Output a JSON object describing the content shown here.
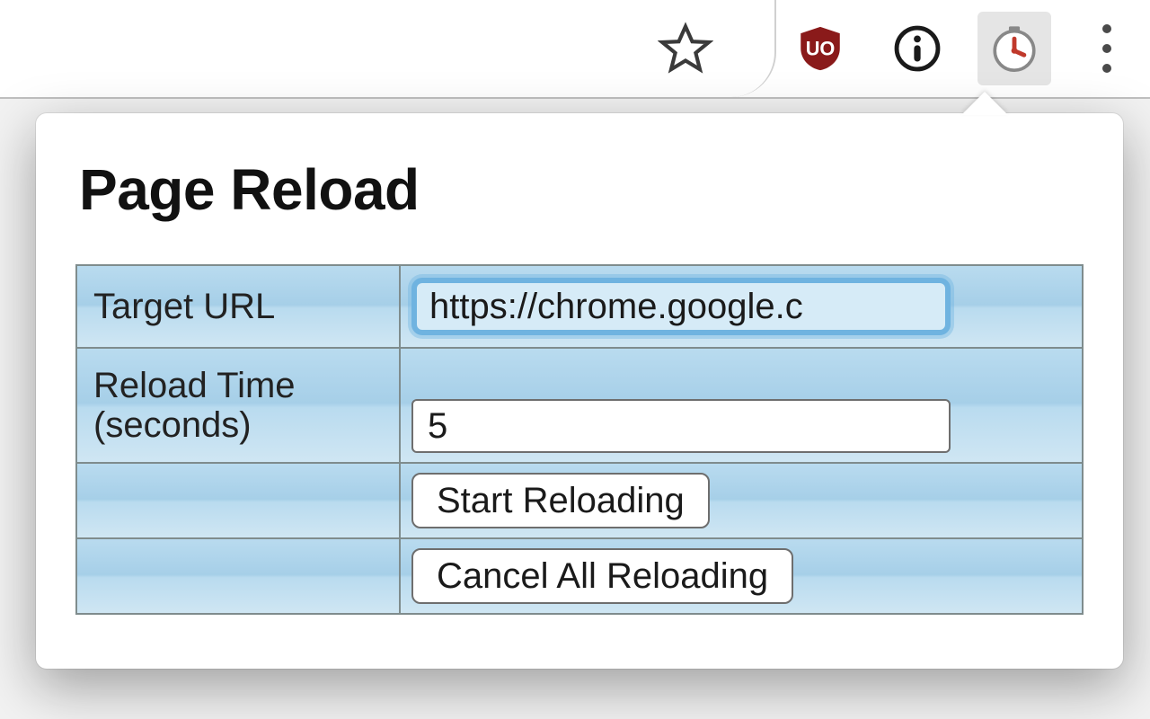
{
  "toolbar": {
    "omnibox_value": "",
    "icons": {
      "bookmark": "star-icon",
      "ublock": "ublock-icon",
      "info": "info-icon",
      "timer": "timer-icon",
      "menu": "menu-icon"
    }
  },
  "popup": {
    "title": "Page Reload",
    "rows": {
      "target_url_label": "Target URL",
      "target_url_value": "https://chrome.google.c",
      "reload_time_label": "Reload Time (seconds)",
      "reload_time_value": "5",
      "start_button": "Start Reloading",
      "cancel_button": "Cancel All Reloading"
    }
  }
}
